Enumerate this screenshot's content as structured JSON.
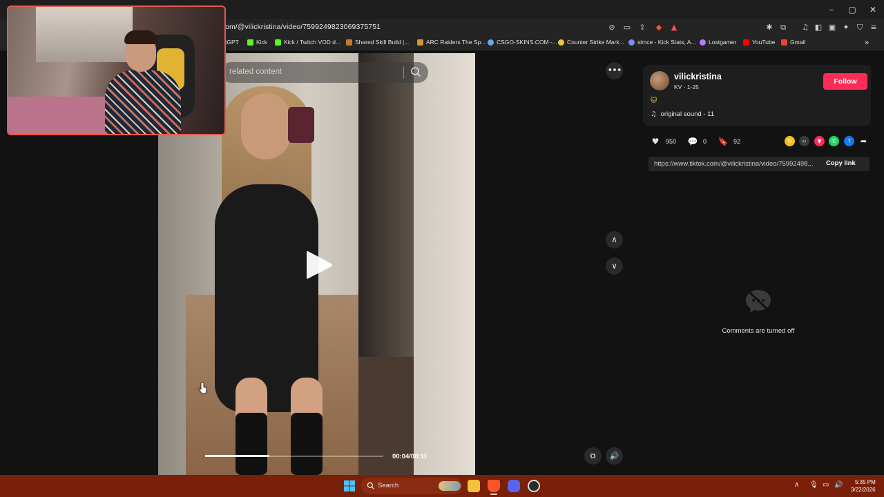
{
  "browser": {
    "url": "om/@vilickristina/video/7599249823069375751",
    "window_controls": [
      "–",
      "▢",
      "✕"
    ],
    "bookmarks": [
      {
        "label": "tGPT",
        "color": "#10a37f"
      },
      {
        "label": "Kick",
        "color": "#53fc18"
      },
      {
        "label": "Kick / Twitch VOD d...",
        "color": "#53fc18"
      },
      {
        "label": "Shared Skill Build |...",
        "color": "#c8782a"
      },
      {
        "label": "ARC Raiders The Sp...",
        "color": "#d9952f"
      },
      {
        "label": "CSGO-SKINS.COM -...",
        "color": "#6aa6e8"
      },
      {
        "label": "Counter Strike Mark...",
        "color": "#f2c53d"
      },
      {
        "label": "simce - Kick Stats, A...",
        "color": "#7a8cf0"
      },
      {
        "label": "Lostgamer",
        "color": "#b57cf2"
      },
      {
        "label": "YouTube",
        "color": "#ff0000"
      },
      {
        "label": "Gmail",
        "color": "#ea4335"
      }
    ],
    "bookmarks_overflow": "»"
  },
  "video": {
    "search_placeholder": "related content",
    "time": "00:04/00:11",
    "progress": 0.36
  },
  "author": {
    "username": "vilickristina",
    "meta": "KV · 1-25",
    "follow_label": "Follow",
    "emoji": "🐱",
    "sound": "original sound - 11",
    "sound_icon": "♫"
  },
  "stats": {
    "likes": "950",
    "comments": "0",
    "saves": "92"
  },
  "share_icons": [
    {
      "name": "repost",
      "color": "#f2c318",
      "glyph": "↻"
    },
    {
      "name": "embed",
      "color": "#3a3a3a",
      "glyph": "‹›"
    },
    {
      "name": "send",
      "color": "#fe2c55",
      "glyph": "▼"
    },
    {
      "name": "whatsapp",
      "color": "#25d366",
      "glyph": "✆"
    },
    {
      "name": "facebook",
      "color": "#1877f2",
      "glyph": "f"
    },
    {
      "name": "share-more",
      "color": "transparent",
      "glyph": "➦"
    }
  ],
  "link": {
    "url": "https://www.tiktok.com/@vilickristina/video/75992498...",
    "copy_label": "Copy link"
  },
  "comments": {
    "status": "Comments are turned off"
  },
  "taskbar": {
    "search_label": "Search",
    "time": "5:35 PM",
    "date": "3/22/2026"
  },
  "colors": {
    "accent": "#fe2c55",
    "taskbar": "#7a1f08",
    "webcam_border": "#e85a4e"
  }
}
